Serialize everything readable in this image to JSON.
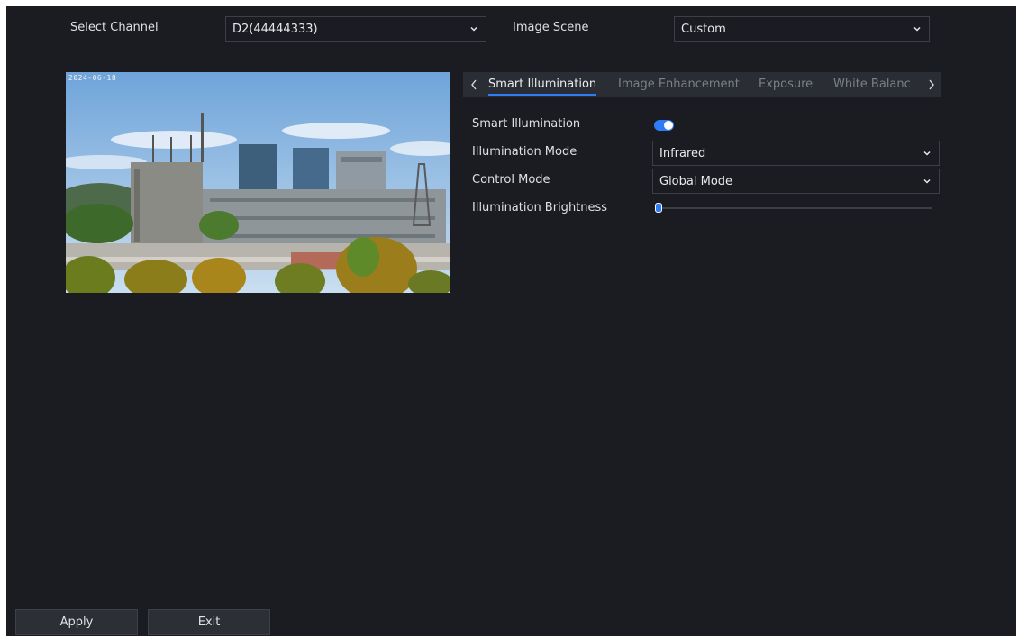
{
  "header": {
    "channel_label": "Select Channel",
    "channel_value": "D2(44444333)",
    "scene_label": "Image Scene",
    "scene_value": "Custom"
  },
  "preview": {
    "osd_text": "2024-06-18"
  },
  "tabs": {
    "prev_icon": "chevron-left-icon",
    "next_icon": "chevron-right-icon",
    "items": [
      {
        "label": "Smart Illumination",
        "active": true
      },
      {
        "label": "Image Enhancement",
        "active": false
      },
      {
        "label": "Exposure",
        "active": false
      },
      {
        "label": "White Balanc",
        "active": false
      }
    ]
  },
  "settings": {
    "smart_illumination_label": "Smart Illumination",
    "smart_illumination_on": true,
    "illumination_mode_label": "Illumination Mode",
    "illumination_mode_value": "Infrared",
    "control_mode_label": "Control Mode",
    "control_mode_value": "Global Mode",
    "illumination_brightness_label": "Illumination Brightness",
    "illumination_brightness_value": 0
  },
  "footer": {
    "apply_label": "Apply",
    "exit_label": "Exit"
  },
  "colors": {
    "background": "#1a1c21",
    "accent": "#2f7df6",
    "tab_bar": "#2a2d34"
  }
}
